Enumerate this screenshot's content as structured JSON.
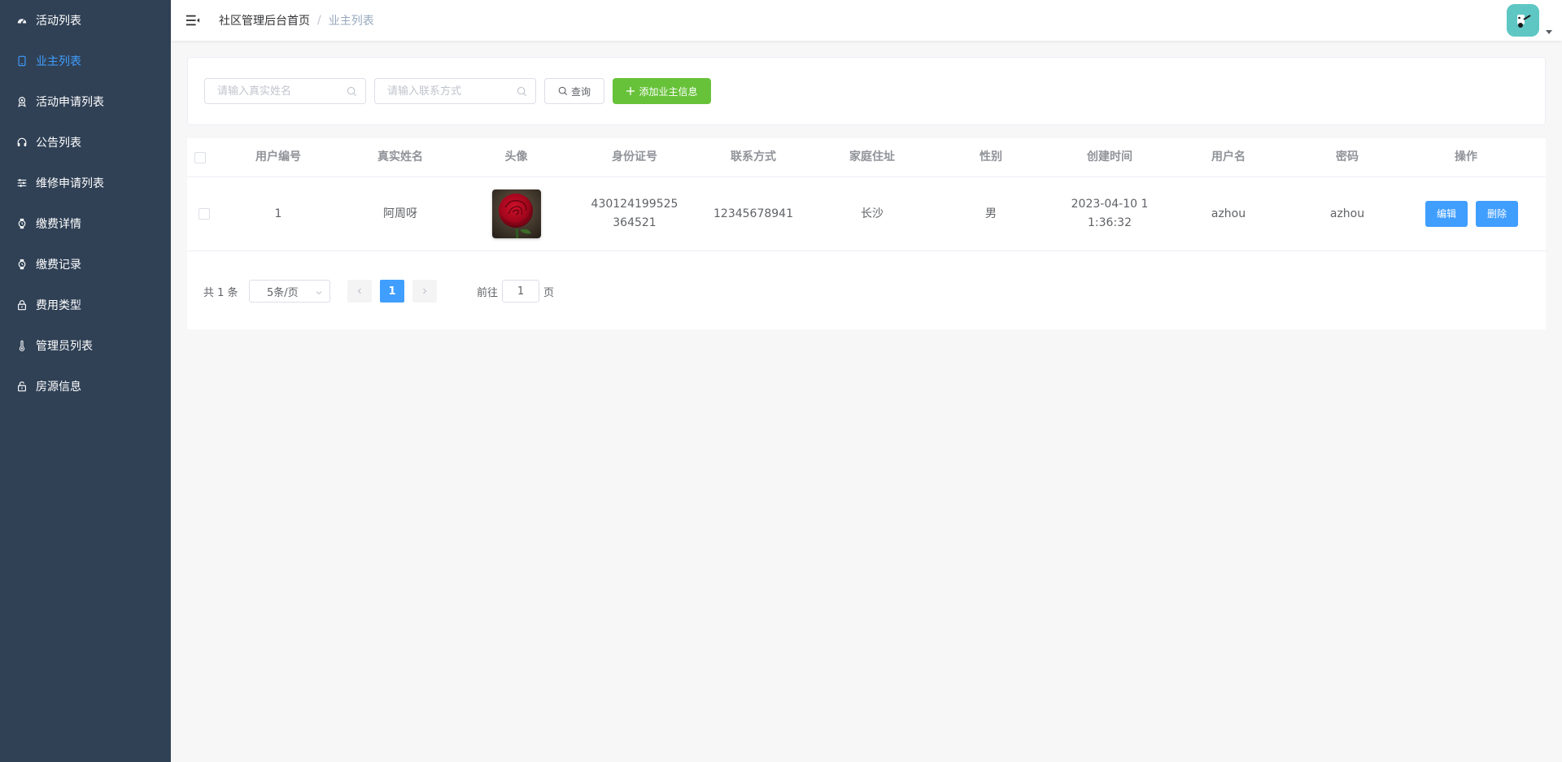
{
  "sidebar": {
    "items": [
      {
        "label": "活动列表",
        "icon": "dashboard-icon",
        "active": false
      },
      {
        "label": "业主列表",
        "icon": "tablet-icon",
        "active": true
      },
      {
        "label": "活动申请列表",
        "icon": "medal-icon",
        "active": false
      },
      {
        "label": "公告列表",
        "icon": "headset-icon",
        "active": false
      },
      {
        "label": "维修申请列表",
        "icon": "sliders-icon",
        "active": false
      },
      {
        "label": "缴费详情",
        "icon": "watch-icon",
        "active": false
      },
      {
        "label": "缴费记录",
        "icon": "watch-icon",
        "active": false
      },
      {
        "label": "费用类型",
        "icon": "lock-icon",
        "active": false
      },
      {
        "label": "管理员列表",
        "icon": "thermometer-icon",
        "active": false
      },
      {
        "label": "房源信息",
        "icon": "unlock-icon",
        "active": false
      }
    ]
  },
  "header": {
    "breadcrumb": {
      "home": "社区管理后台首页",
      "separator": "/",
      "current": "业主列表"
    }
  },
  "search": {
    "name_placeholder": "请输入真实姓名",
    "contact_placeholder": "请输入联系方式",
    "query_label": "查询",
    "add_label": "添加业主信息"
  },
  "table": {
    "headers": {
      "id": "用户编号",
      "real_name": "真实姓名",
      "avatar": "头像",
      "id_card": "身份证号",
      "contact": "联系方式",
      "address": "家庭住址",
      "gender": "性别",
      "created": "创建时间",
      "username": "用户名",
      "password": "密码",
      "actions": "操作"
    },
    "rows": [
      {
        "id": "1",
        "real_name": "阿周呀",
        "id_card": "430124199525364521",
        "contact": "12345678941",
        "address": "长沙",
        "gender": "男",
        "created": "2023-04-10 11:36:32",
        "username": "azhou",
        "password": "azhou",
        "edit_label": "编辑",
        "delete_label": "删除"
      }
    ]
  },
  "pagination": {
    "total": "共 1 条",
    "page_size": "5条/页",
    "current_page": "1",
    "jump_prefix": "前往",
    "jump_value": "1",
    "jump_suffix": "页"
  },
  "colors": {
    "sidebar_bg": "#304156",
    "primary": "#409eff",
    "success": "#67c23a",
    "avatar_bg": "#5ec7c4"
  }
}
